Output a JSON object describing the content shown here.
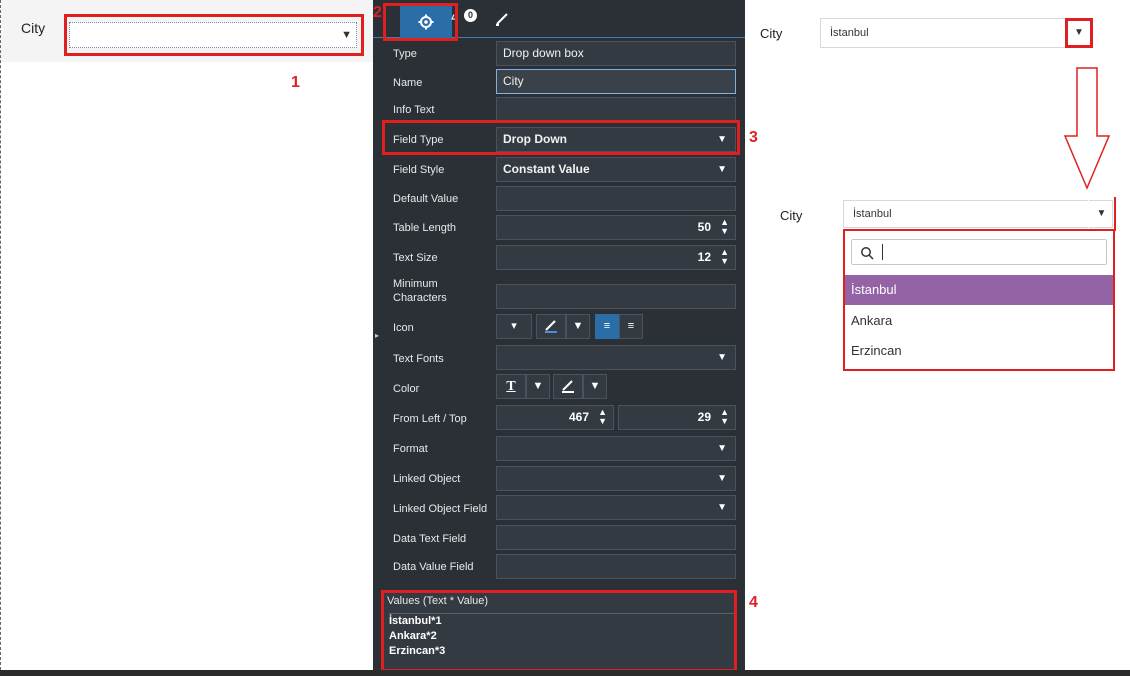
{
  "canvas": {
    "city_label": "City",
    "annot1": "1"
  },
  "panel": {
    "annot2": "2",
    "annot3": "3",
    "annot4": "4",
    "tabs": {
      "events_badge": "0"
    },
    "fields": {
      "type": {
        "label": "Type",
        "value": "Drop down box"
      },
      "name": {
        "label": "Name",
        "value": "City"
      },
      "info_text": {
        "label": "Info Text",
        "value": ""
      },
      "field_type": {
        "label": "Field Type",
        "value": "Drop Down"
      },
      "field_style": {
        "label": "Field Style",
        "value": "Constant Value"
      },
      "default_value": {
        "label": "Default Value",
        "value": ""
      },
      "table_length": {
        "label": "Table Length",
        "value": "50"
      },
      "text_size": {
        "label": "Text Size",
        "value": "12"
      },
      "minimum_characters": {
        "label": "Minimum Characters",
        "value": ""
      },
      "icon": {
        "label": "Icon"
      },
      "text_fonts": {
        "label": "Text Fonts",
        "value": ""
      },
      "color": {
        "label": "Color"
      },
      "from_left_top": {
        "label": "From Left / Top",
        "left": "467",
        "top": "29"
      },
      "format": {
        "label": "Format",
        "value": ""
      },
      "linked_object": {
        "label": "Linked Object",
        "value": ""
      },
      "linked_object_field": {
        "label": "Linked Object Field",
        "value": ""
      },
      "data_text_field": {
        "label": "Data Text Field",
        "value": ""
      },
      "data_value_field": {
        "label": "Data Value Field",
        "value": ""
      }
    },
    "values": {
      "header": "Values (Text * Value)",
      "lines": [
        "İstanbul*1",
        "Ankara*2",
        "Erzincan*3"
      ]
    }
  },
  "preview": {
    "city_label": "City",
    "selected_value": "İstanbul",
    "options": [
      "İstanbul",
      "Ankara",
      "Erzincan"
    ]
  },
  "colors": {
    "panel_bg": "#2b3037",
    "accent_blue": "#2a6ea8",
    "highlight_red": "#e02020",
    "selected_option": "#9463a6"
  }
}
